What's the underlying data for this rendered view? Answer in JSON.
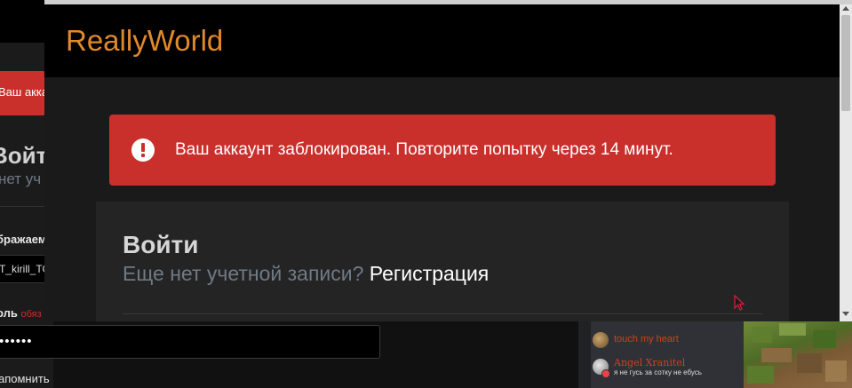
{
  "background_window": {
    "alert_text": "Ваш акка",
    "title": "Войти",
    "subtitle": "нет уч",
    "username_label": "бражаем",
    "username_value": "T_kirill_TO",
    "password_label": "оль",
    "password_required": "обяз",
    "password_value": "••••••",
    "remember_label": "апомнить"
  },
  "main_window": {
    "logo": "ReallyWorld",
    "alert": {
      "icon": "exclamation-circle-icon",
      "text": "Ваш аккаунт заблокирован. Повторите попытку через 14 минут."
    },
    "login": {
      "title": "Войти",
      "no_account_text": "Еще нет учетной записи?",
      "register_link": "Регистрация"
    }
  },
  "voice_overlay": {
    "users": [
      {
        "name": "touch my heart",
        "status": "",
        "color": "#d1401f"
      },
      {
        "name": "Angel Xranitel",
        "status": "я не гусь за сотку не ебусь",
        "color": "#d1401f"
      }
    ]
  },
  "colors": {
    "brand": "#e0892a",
    "alert": "#c9302c",
    "muted_text": "#6f7a86"
  }
}
